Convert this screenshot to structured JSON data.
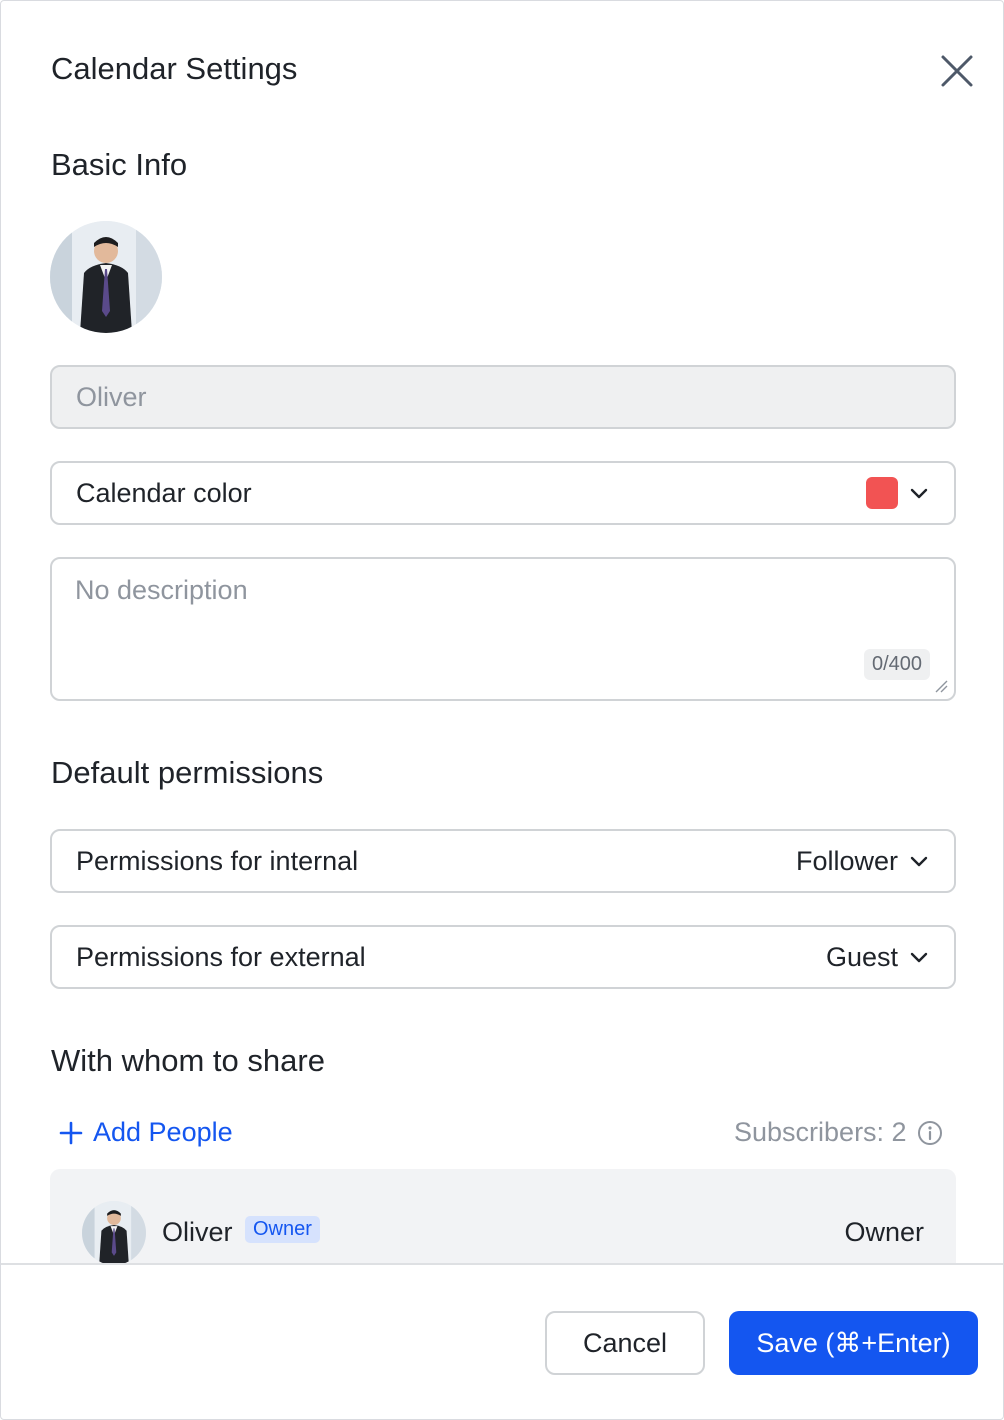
{
  "dialog": {
    "title": "Calendar Settings",
    "close_icon": "close-icon"
  },
  "basic_info": {
    "heading": "Basic Info",
    "name_value": "Oliver",
    "color_label": "Calendar color",
    "color_value": "#f25353",
    "description_placeholder": "No description",
    "description_counter": "0/400"
  },
  "permissions": {
    "heading": "Default permissions",
    "internal_label": "Permissions for internal",
    "internal_value": "Follower",
    "external_label": "Permissions for external",
    "external_value": "Guest"
  },
  "share": {
    "heading": "With whom to share",
    "add_people_label": "Add People",
    "subscribers_label": "Subscribers: 2",
    "members": [
      {
        "name": "Oliver",
        "badge": "Owner",
        "role": "Owner"
      }
    ]
  },
  "footer": {
    "cancel_label": "Cancel",
    "save_label": "Save (⌘+Enter)"
  },
  "colors": {
    "accent": "#1456f0",
    "calendar_color": "#f25353"
  }
}
